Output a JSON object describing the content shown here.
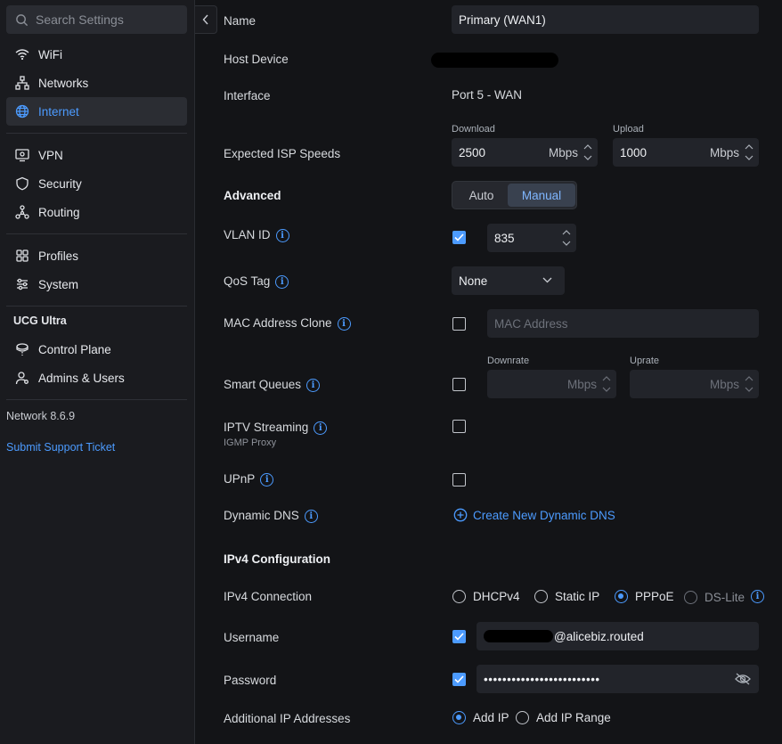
{
  "sidebar": {
    "search_placeholder": "Search Settings",
    "items": [
      {
        "label": "WiFi",
        "icon": "wifi-icon"
      },
      {
        "label": "Networks",
        "icon": "networks-icon"
      },
      {
        "label": "Internet",
        "icon": "globe-icon",
        "active": true
      },
      {
        "label": "VPN",
        "icon": "vpn-icon"
      },
      {
        "label": "Security",
        "icon": "shield-icon"
      },
      {
        "label": "Routing",
        "icon": "routing-icon"
      },
      {
        "label": "Profiles",
        "icon": "profiles-icon"
      },
      {
        "label": "System",
        "icon": "system-icon"
      }
    ],
    "device_section_title": "UCG Ultra",
    "device_items": [
      {
        "label": "Control Plane",
        "icon": "control-plane-icon"
      },
      {
        "label": "Admins & Users",
        "icon": "users-icon"
      }
    ],
    "version": "Network 8.6.9",
    "support_link": "Submit Support Ticket"
  },
  "form": {
    "name_label": "Name",
    "name_value": "Primary (WAN1)",
    "host_device_label": "Host Device",
    "interface_label": "Interface",
    "interface_value": "Port 5 - WAN",
    "isp_speeds_label": "Expected ISP Speeds",
    "download_label": "Download",
    "download_value": "2500",
    "upload_label": "Upload",
    "upload_value": "1000",
    "unit": "Mbps",
    "advanced_label": "Advanced",
    "advanced_options": [
      "Auto",
      "Manual"
    ],
    "advanced_selected": "Manual",
    "vlan_label": "VLAN ID",
    "vlan_enabled": true,
    "vlan_value": "835",
    "qos_label": "QoS Tag",
    "qos_value": "None",
    "mac_clone_label": "MAC Address Clone",
    "mac_clone_enabled": false,
    "mac_placeholder": "MAC Address",
    "smart_queues_label": "Smart Queues",
    "smart_queues_enabled": false,
    "downrate_label": "Downrate",
    "uprate_label": "Uprate",
    "iptv_label": "IPTV Streaming",
    "iptv_sub": "IGMP Proxy",
    "iptv_enabled": false,
    "upnp_label": "UPnP",
    "upnp_enabled": false,
    "ddns_label": "Dynamic DNS",
    "ddns_link": "Create New Dynamic DNS",
    "ipv4_section": "IPv4 Configuration",
    "ipv4_conn_label": "IPv4 Connection",
    "ipv4_options": [
      "DHCPv4",
      "Static IP",
      "PPPoE",
      "DS-Lite"
    ],
    "ipv4_selected": "PPPoE",
    "username_label": "Username",
    "username_enabled": true,
    "username_value": "@alicebiz.routed",
    "password_label": "Password",
    "password_enabled": true,
    "password_value": "•••••••••••••••••••••••••",
    "additional_ip_label": "Additional IP Addresses",
    "additional_ip_options": [
      "Add IP",
      "Add IP Range"
    ],
    "additional_ip_selected": "Add IP"
  },
  "colors": {
    "accent": "#4c9bff",
    "sidebar_bg": "#1a1b1f",
    "content_bg": "#131417",
    "field_bg": "#22242a"
  }
}
